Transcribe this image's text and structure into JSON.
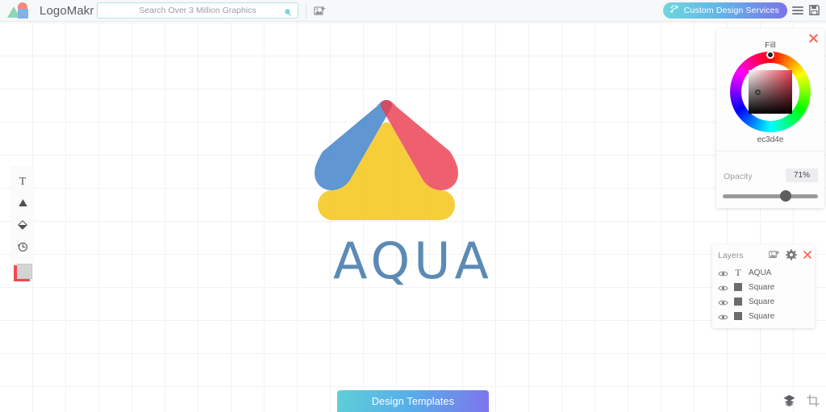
{
  "app": {
    "brand_name": "LogoMakr"
  },
  "topbar": {
    "search": {
      "placeholder": "Search Over 3 Million Graphics",
      "value": "",
      "icon": "search-icon"
    },
    "add_image_icon": "add-image-icon",
    "custom_design_label": "Custom Design Services",
    "custom_design_icon": "brush-icon",
    "menu_icon": "hamburger-menu-icon",
    "save_icon": "save-disk-icon",
    "gradient_start": "#6fd7dd",
    "gradient_end": "#7b74e8"
  },
  "left_toolbar": {
    "tools": [
      {
        "name": "text-tool",
        "icon": "text-T-icon",
        "label": "T"
      },
      {
        "name": "shape-tool",
        "icon": "triangle-icon",
        "label": ""
      },
      {
        "name": "paint-tool",
        "icon": "paint-shape-icon",
        "label": ""
      },
      {
        "name": "history-tool",
        "icon": "clock-history-icon",
        "label": ""
      }
    ],
    "color_swatch": {
      "back_color": "#ef4d52",
      "front_color": "#d4d4d4"
    }
  },
  "artwork": {
    "logo_text": "AQUA",
    "logo_text_color": "#5b8ab5",
    "shapes": [
      {
        "name": "blue-rounded-shape",
        "color": "#3d7fc8"
      },
      {
        "name": "red-rounded-shape",
        "color": "#ec3d4e"
      },
      {
        "name": "yellow-rounded-shape",
        "color": "#f5c518"
      }
    ]
  },
  "fill_panel": {
    "title": "Fill",
    "hex": "ec3d4e",
    "opacity_label": "Opacity",
    "opacity_value": "71%",
    "opacity_percent": 71,
    "close_icon": "close-x-icon"
  },
  "layers_panel": {
    "title": "Layers",
    "add_icon": "add-image-icon",
    "settings_icon": "gear-icon",
    "close_icon": "close-x-icon",
    "items": [
      {
        "name": "AQUA",
        "type": "text",
        "visible": true
      },
      {
        "name": "Square",
        "type": "shape",
        "visible": true
      },
      {
        "name": "Square",
        "type": "shape",
        "visible": true
      },
      {
        "name": "Square",
        "type": "shape",
        "visible": true
      }
    ]
  },
  "bottom": {
    "design_templates_label": "Design Templates",
    "layers_icon": "stacked-layers-icon",
    "crop_icon": "crop-icon"
  }
}
